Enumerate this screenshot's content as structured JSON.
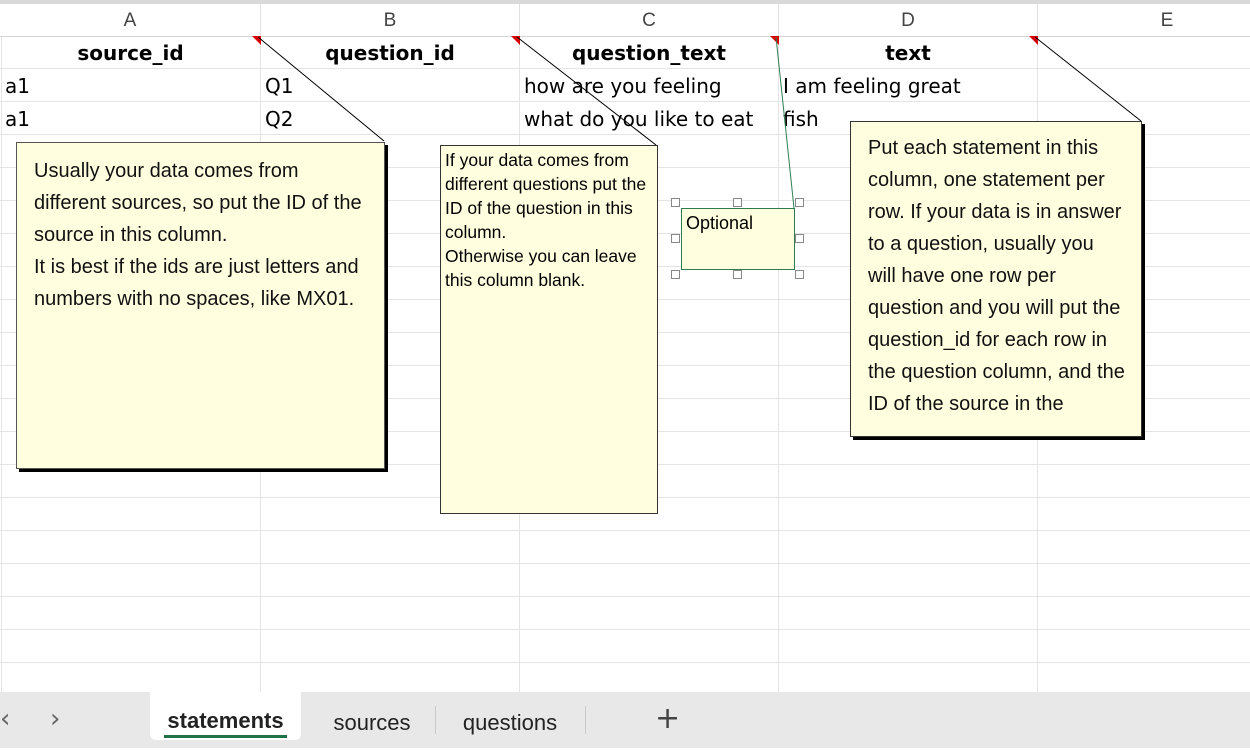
{
  "columns": [
    "A",
    "B",
    "C",
    "D",
    "E"
  ],
  "header_row": {
    "source_id": "source_id",
    "question_id": "question_id",
    "question_text": "question_text",
    "text": "text"
  },
  "rows": [
    {
      "source_id": "a1",
      "question_id": "Q1",
      "question_text": "how are you feeling",
      "text": "I am feeling great"
    },
    {
      "source_id": "a1",
      "question_id": "Q2",
      "question_text": "what do you like to eat",
      "text": "fish"
    }
  ],
  "comments": {
    "source_id": "Usually your data comes from different sources, so put the ID of the source in this column.\nIt is best if the ids are just letters and numbers with no spaces, like MX01.",
    "question_id": "If your data comes from different questions put the ID of the question in this column.\nOtherwise you can leave this column blank.",
    "question_text": "Optional",
    "text": "Put each statement in this column, one statement per row. If your data is in answer to a question, usually you will have one row per question and you will put the question_id for each row in the question column, and the ID of the source in the"
  },
  "sheet_tabs": [
    {
      "label": "statements",
      "active": true
    },
    {
      "label": "sources",
      "active": false
    },
    {
      "label": "questions",
      "active": false
    }
  ],
  "nav": {
    "prev": "‹",
    "next": "›",
    "add": "+"
  },
  "colors": {
    "accent": "#1e7145",
    "note_bg": "#ffffe0",
    "marker": "#d90000"
  }
}
